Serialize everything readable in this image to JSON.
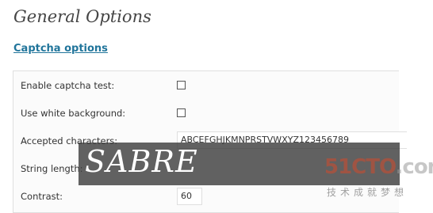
{
  "header": {
    "title": "General Options"
  },
  "section": {
    "link_label": "Captcha options"
  },
  "options": {
    "enable_captcha_label": "Enable captcha test:",
    "enable_captcha_checked": false,
    "white_background_label": "Use white background:",
    "white_background_checked": false,
    "accepted_characters_label": "Accepted characters:",
    "accepted_characters_value": "ABCEFGHJKMNPRSTVWXYZ123456789",
    "string_length_label": "String length:",
    "contrast_label": "Contrast:",
    "contrast_value": "60"
  },
  "overlay": {
    "text": "SABRE"
  },
  "watermark": {
    "logo_main": "51CTO",
    "logo_suffix": ".com",
    "tagline": "技术成就梦想"
  },
  "colors": {
    "link": "#21759b",
    "title": "#464646",
    "overlay_bg": "#3e3e3e",
    "watermark_red": "#d24a2c"
  }
}
